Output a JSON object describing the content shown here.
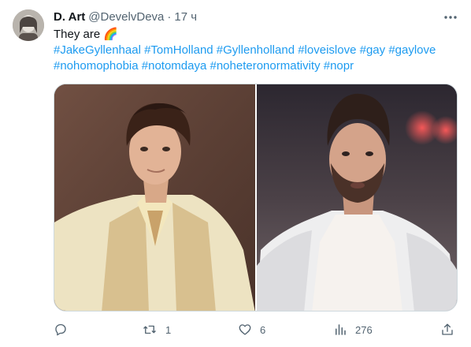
{
  "tweet": {
    "author": {
      "display_name": "D. Art",
      "handle": "@DevelvDeva",
      "separator": "·",
      "timestamp": "17 ч"
    },
    "text": {
      "intro": "They are",
      "emoji": "🌈",
      "hashtags_line1": [
        "#JakeGyllenhaal",
        "#TomHolland",
        "#Gyllenholland",
        "#loveislove",
        "#gay",
        "#gaylove"
      ],
      "hashtags_line2": [
        "#nohomophobia",
        "#notomdaya",
        "#noheteronormativity",
        "#nopr"
      ]
    },
    "media": {
      "images": [
        {
          "name": "photo-left",
          "description_icon": "portrait-photo"
        },
        {
          "name": "photo-right",
          "description_icon": "portrait-photo"
        }
      ]
    },
    "actions": {
      "reply": {
        "icon": "reply-icon",
        "count": ""
      },
      "retweet": {
        "icon": "retweet-icon",
        "count": "1"
      },
      "like": {
        "icon": "heart-icon",
        "count": "6"
      },
      "views": {
        "icon": "views-icon",
        "count": "276"
      },
      "share": {
        "icon": "share-icon",
        "count": ""
      }
    },
    "colors": {
      "link": "#1d9bf0",
      "secondary_text": "#536471",
      "primary_text": "#0f1419",
      "border": "#cfd9de"
    }
  }
}
